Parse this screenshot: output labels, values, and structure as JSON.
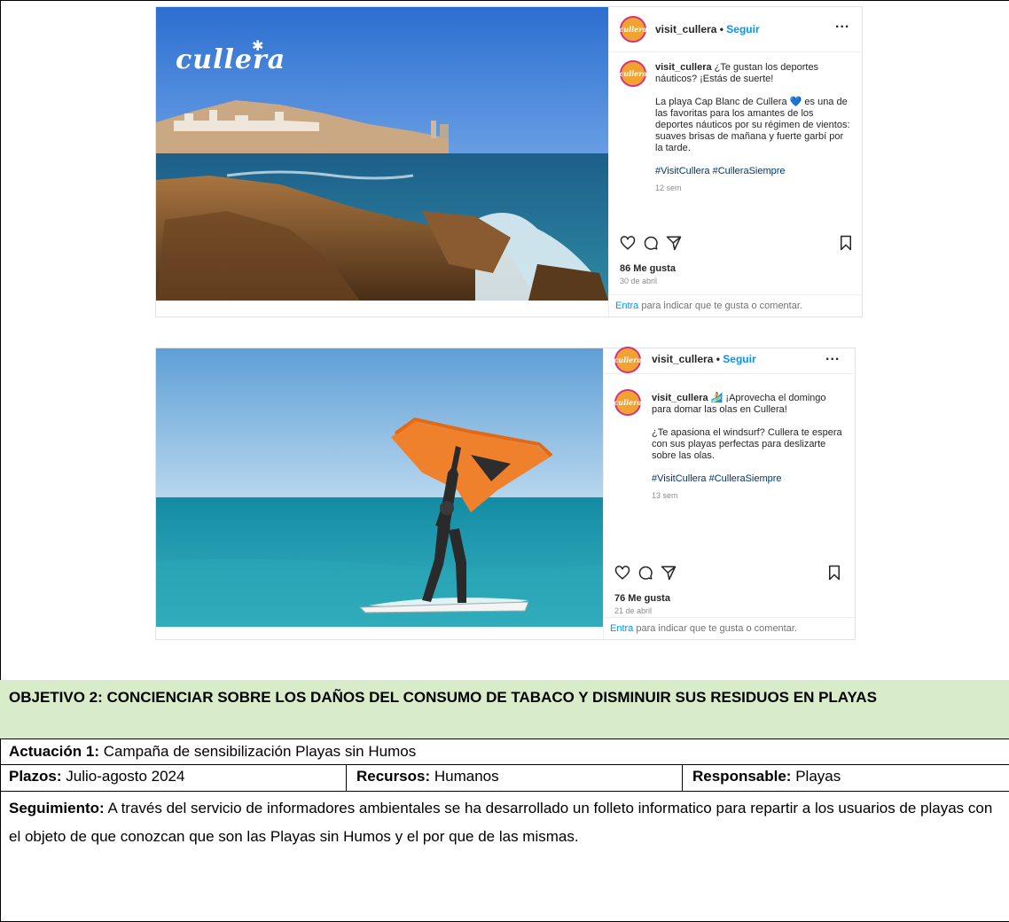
{
  "posts": [
    {
      "username": "visit_cullera",
      "separator": "•",
      "follow_label": "Seguir",
      "more_label": "...",
      "avatar_text": "cullera",
      "photo_logo": "cullera",
      "caption_user": "visit_cullera",
      "caption_lines": [
        "¿Te gustan los deportes náuticos? ¡Estás de suerte!",
        "La playa Cap Blanc de Cullera 💙 es una de las favoritas para los amantes de los deportes náuticos por su régimen de vientos: suaves brisas de mañana y fuerte garbí por la tarde."
      ],
      "hashtags": "#VisitCullera #CulleraSiempre",
      "time_ago": "12 sem",
      "likes": "86 Me gusta",
      "date": "30 de abril",
      "login_link": "Entra",
      "login_text": " para indicar que te gusta o comentar."
    },
    {
      "username": "visit_cullera",
      "separator": "•",
      "follow_label": "Seguir",
      "more_label": "...",
      "avatar_text": "cullera",
      "caption_user": "visit_cullera",
      "caption_lines": [
        "🏄 ¡Aprovecha el domingo para domar las olas en Cullera!",
        "¿Te apasiona el windsurf? Cullera te espera con sus playas perfectas para deslizarte sobre las olas."
      ],
      "hashtags": "#VisitCullera #CulleraSiempre",
      "time_ago": "13 sem",
      "likes": "76 Me gusta",
      "date": "21 de abril",
      "login_link": "Entra",
      "login_text": " para indicar que te gusta o comentar."
    }
  ],
  "table": {
    "objective": "OBJETIVO 2: CONCIENCIAR SOBRE LOS DAÑOS DEL CONSUMO DE TABACO Y DISMINUIR SUS RESIDUOS EN PLAYAS",
    "action_label": "Actuación 1:",
    "action_value": " Campaña de sensibilización Playas sin Humos",
    "deadline_label": "Plazos:",
    "deadline_value": " Julio-agosto 2024",
    "resources_label": "Recursos:",
    "resources_value": " Humanos",
    "responsible_label": "Responsable:",
    "responsible_value": " Playas",
    "followup_label": "Seguimiento:",
    "followup_value": " A través del servicio de informadores ambientales se ha desarrollado un folleto informatico para repartir a los usuarios de playas con el objeto de que conozcan que son las Playas sin Humos y el por que de las mismas."
  },
  "colors": {
    "objective_bg": "#d8ecc9",
    "link_blue": "#0095f6",
    "hashtag_blue": "#00376b",
    "muted": "#8e8e8e"
  }
}
